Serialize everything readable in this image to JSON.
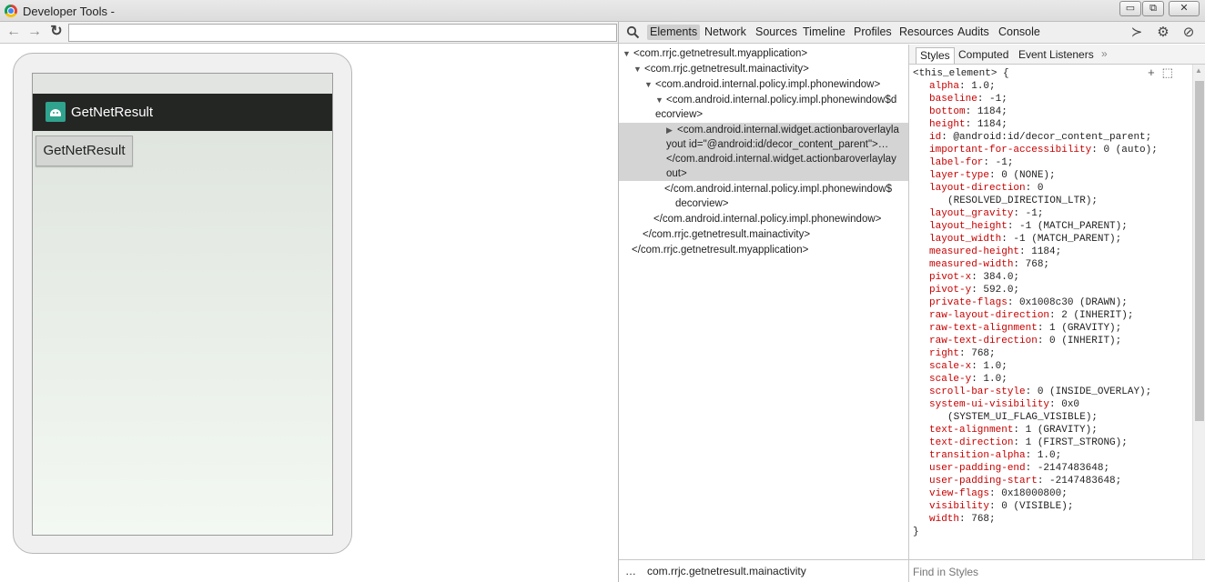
{
  "window": {
    "title": "Developer Tools -",
    "min": "▭",
    "max": "⧉",
    "close": "✕"
  },
  "browser": {
    "back": "←",
    "forward": "→",
    "reload": "↻",
    "url_value": ""
  },
  "device": {
    "app_title": "GetNetResult",
    "button_label": "GetNetResult"
  },
  "devtools": {
    "tabs": [
      "Elements",
      "Network",
      "Sources",
      "Timeline",
      "Profiles",
      "Resources",
      "Audits",
      "Console"
    ],
    "active_tab": "Elements",
    "toolbar_icons": [
      "console-drawer-icon",
      "gear-icon",
      "dock-icon"
    ]
  },
  "tree": {
    "rows": [
      "<com.rrjc.getnetresult.myapplication>",
      "<com.rrjc.getnetresult.mainactivity>",
      "<com.android.internal.policy.impl.phonewindow>",
      "<com.android.internal.policy.impl.phonewindow$d",
      "ecorview>",
      "<com.android.internal.widget.actionbaroverlayla",
      "yout id=\"@android:id/decor_content_parent\">…",
      "</com.android.internal.widget.actionbaroverlaylay",
      "out>",
      "</com.android.internal.policy.impl.phonewindow$",
      "decorview>",
      "</com.android.internal.policy.impl.phonewindow>",
      "</com.rrjc.getnetresult.mainactivity>",
      "</com.rrjc.getnetresult.myapplication>"
    ],
    "footer_dots": "…",
    "breadcrumb": "com.rrjc.getnetresult.mainactivity"
  },
  "styles": {
    "tabs": [
      "Styles",
      "Computed",
      "Event Listeners"
    ],
    "more": "»",
    "rule_header": "<this_element> {",
    "rule_actions": "+ ⬚",
    "props": [
      [
        "alpha",
        "1.0;"
      ],
      [
        "baseline",
        "-1;"
      ],
      [
        "bottom",
        "1184;"
      ],
      [
        "height",
        "1184;"
      ],
      [
        "id",
        "@android:id/decor_content_parent;"
      ],
      [
        "important-for-accessibility",
        "0 (auto);"
      ],
      [
        "label-for",
        "-1;"
      ],
      [
        "layer-type",
        "0 (NONE);"
      ],
      [
        "layout-direction",
        "0"
      ],
      [
        "",
        "(RESOLVED_DIRECTION_LTR);"
      ],
      [
        "layout_gravity",
        "-1;"
      ],
      [
        "layout_height",
        "-1 (MATCH_PARENT);"
      ],
      [
        "layout_width",
        "-1 (MATCH_PARENT);"
      ],
      [
        "measured-height",
        "1184;"
      ],
      [
        "measured-width",
        "768;"
      ],
      [
        "pivot-x",
        "384.0;"
      ],
      [
        "pivot-y",
        "592.0;"
      ],
      [
        "private-flags",
        "0x1008c30 (DRAWN);"
      ],
      [
        "raw-layout-direction",
        "2 (INHERIT);"
      ],
      [
        "raw-text-alignment",
        "1 (GRAVITY);"
      ],
      [
        "raw-text-direction",
        "0 (INHERIT);"
      ],
      [
        "right",
        "768;"
      ],
      [
        "scale-x",
        "1.0;"
      ],
      [
        "scale-y",
        "1.0;"
      ],
      [
        "scroll-bar-style",
        "0 (INSIDE_OVERLAY);"
      ],
      [
        "system-ui-visibility",
        "0x0"
      ],
      [
        "",
        "(SYSTEM_UI_FLAG_VISIBLE);"
      ],
      [
        "text-alignment",
        "1 (GRAVITY);"
      ],
      [
        "text-direction",
        "1 (FIRST_STRONG);"
      ],
      [
        "transition-alpha",
        "1.0;"
      ],
      [
        "user-padding-end",
        "-2147483648;"
      ],
      [
        "user-padding-start",
        "-2147483648;"
      ],
      [
        "view-flags",
        "0x18000800;"
      ],
      [
        "visibility",
        "0 (VISIBLE);"
      ],
      [
        "width",
        "768;"
      ]
    ],
    "rule_close": "}",
    "find_placeholder": "Find in Styles"
  },
  "colors": {
    "prop_name": "#c80000",
    "action_bar": "#242624",
    "app_icon": "#2fa38e"
  }
}
